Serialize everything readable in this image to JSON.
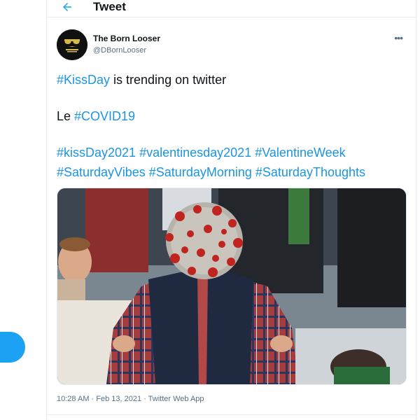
{
  "header": {
    "title": "Tweet"
  },
  "author": {
    "name": "The Born Looser",
    "handle": "@DBornLooser"
  },
  "tweet": {
    "line1": {
      "hashtag": "#KissDay",
      "text": " is trending on twitter"
    },
    "line2": {
      "text": "Le ",
      "hashtag": "#COVID19"
    },
    "hashtags_line1": [
      "#kissDay2021",
      "#valentinesday2021",
      "#ValentineWeek"
    ],
    "hashtags_line2": [
      "#SaturdayVibes",
      "#SaturdayMorning",
      "#SaturdayThoughts"
    ]
  },
  "meta": {
    "timestamp": "10:28 AM · Feb 13, 2021 · Twitter Web App"
  },
  "colors": {
    "accent": "#1da1f2",
    "hashtag": "#1b95e0",
    "muted": "#5b7083"
  },
  "icons": {
    "back": "arrow-left-icon",
    "more": "more-horizontal-icon"
  }
}
